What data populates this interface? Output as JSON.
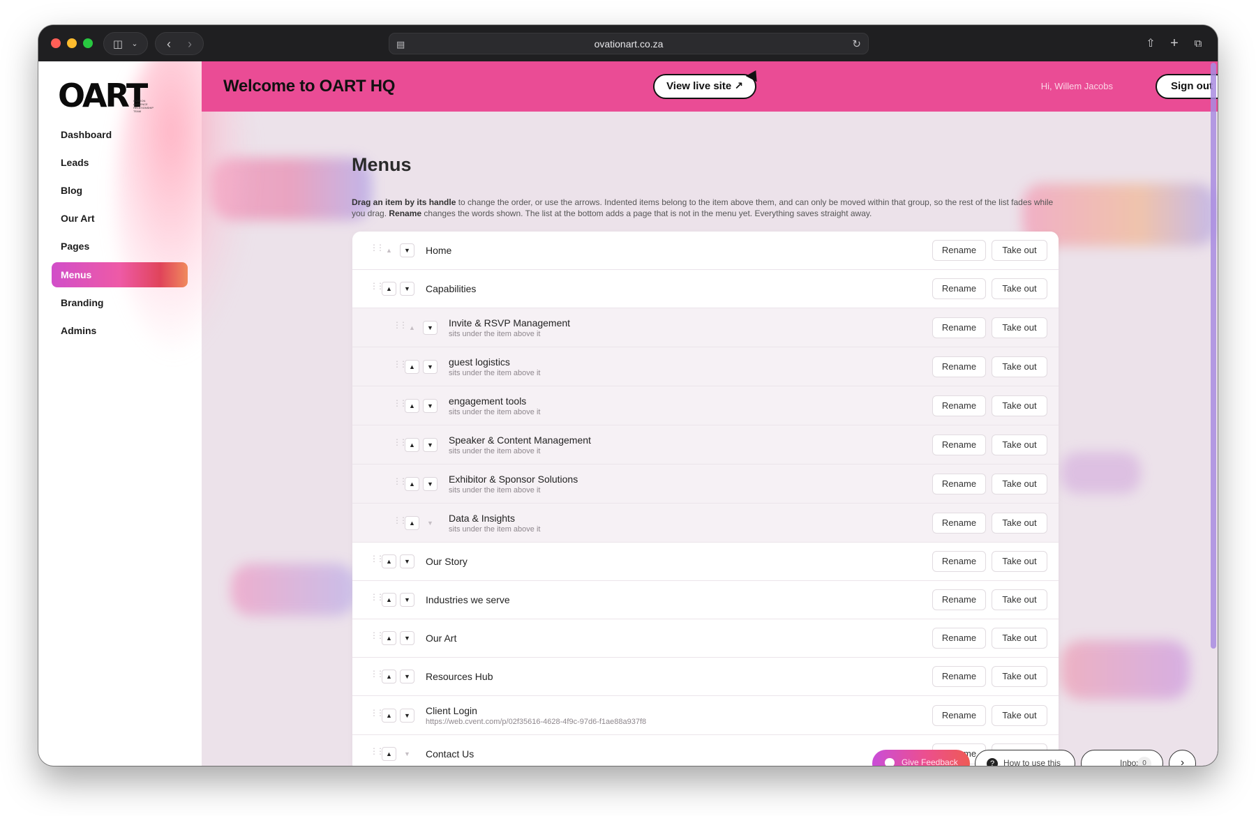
{
  "browser": {
    "url": "ovationart.co.za"
  },
  "sidebar": {
    "logo": "OART",
    "logo_sub": "OVATION AUDIENCE RELATIONSHIP TEAM",
    "items": [
      {
        "label": "Dashboard",
        "active": false
      },
      {
        "label": "Leads",
        "active": false
      },
      {
        "label": "Blog",
        "active": false
      },
      {
        "label": "Our Art",
        "active": false
      },
      {
        "label": "Pages",
        "active": false
      },
      {
        "label": "Menus",
        "active": true
      },
      {
        "label": "Branding",
        "active": false
      },
      {
        "label": "Admins",
        "active": false
      }
    ]
  },
  "header": {
    "title": "Welcome to OART HQ",
    "view_site_label": "View live site ↗",
    "greeting": "Hi, Willem Jacobs",
    "sign_out_label": "Sign out",
    "accent_color": "#ea4c95"
  },
  "main": {
    "title": "Menus",
    "intro_bold_1": "Drag an item by its handle",
    "intro_1": " to change the order, or use the arrows. Indented items belong to the item above them, and can only be moved within that group, so the rest of the list fades while you drag. ",
    "intro_bold_2": "Rename",
    "intro_2": " changes the words shown. The list at the bottom adds a page that is not in the menu yet. Everything saves straight away.",
    "rename_label": "Rename",
    "take_out_label": "Take out",
    "sub_note": "sits under the item above it",
    "items": [
      {
        "label": "Home",
        "level": 0,
        "up_enabled": false,
        "down_enabled": true
      },
      {
        "label": "Capabilities",
        "level": 0,
        "up_enabled": true,
        "down_enabled": true
      },
      {
        "label": "Invite & RSVP Management",
        "level": 1,
        "up_enabled": false,
        "down_enabled": true
      },
      {
        "label": "guest logistics",
        "level": 1,
        "up_enabled": true,
        "down_enabled": true
      },
      {
        "label": "engagement tools",
        "level": 1,
        "up_enabled": true,
        "down_enabled": true
      },
      {
        "label": "Speaker & Content Management",
        "level": 1,
        "up_enabled": true,
        "down_enabled": true
      },
      {
        "label": "Exhibitor & Sponsor Solutions",
        "level": 1,
        "up_enabled": true,
        "down_enabled": true
      },
      {
        "label": "Data & Insights",
        "level": 1,
        "up_enabled": true,
        "down_enabled": false
      },
      {
        "label": "Our Story",
        "level": 0,
        "up_enabled": true,
        "down_enabled": true
      },
      {
        "label": "Industries we serve",
        "level": 0,
        "up_enabled": true,
        "down_enabled": true
      },
      {
        "label": "Our Art",
        "level": 0,
        "up_enabled": true,
        "down_enabled": true
      },
      {
        "label": "Resources Hub",
        "level": 0,
        "up_enabled": true,
        "down_enabled": true
      },
      {
        "label": "Client Login",
        "level": 0,
        "up_enabled": true,
        "down_enabled": true,
        "url": "https://web.cvent.com/p/02f35616-4628-4f9c-97d6-f1ae88a937f8"
      },
      {
        "label": "Contact Us",
        "level": 0,
        "up_enabled": true,
        "down_enabled": false
      }
    ]
  },
  "floating": {
    "feedback_label": "Give Feedback",
    "howto_label": "How to use this",
    "inbox_label": "Inbox",
    "inbox_count": "0",
    "next_icon": "chevron-right-icon"
  }
}
